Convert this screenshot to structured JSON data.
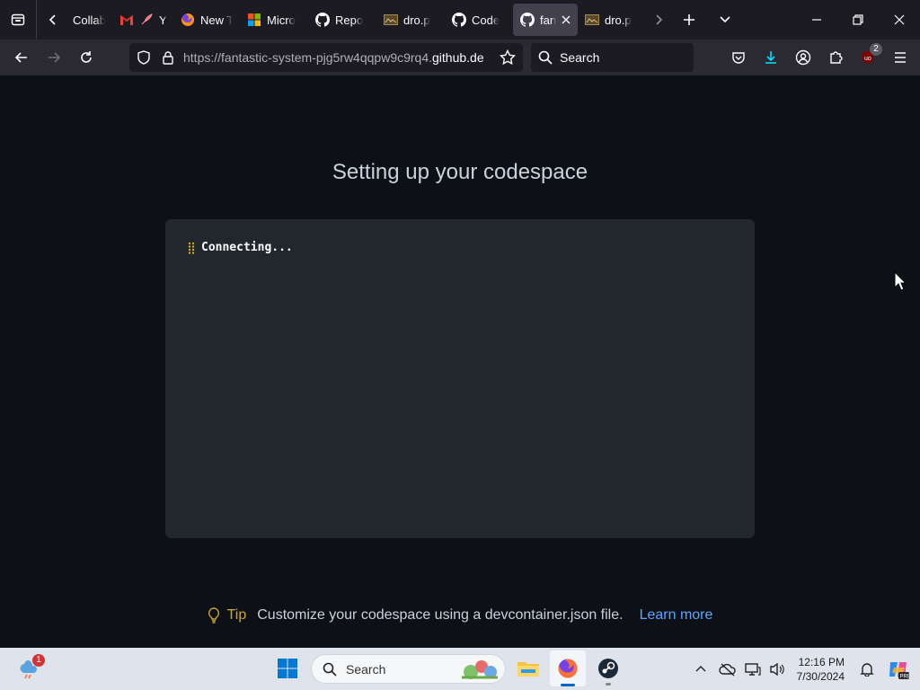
{
  "browser": {
    "tabs": [
      {
        "label": "Collab",
        "icon": "collab-icon"
      },
      {
        "label": "Yo",
        "icon": "gmail-icon"
      },
      {
        "label": "New T",
        "icon": "firefox-icon"
      },
      {
        "label": "Micro",
        "icon": "microsoft-icon"
      },
      {
        "label": "Repo",
        "icon": "github-icon"
      },
      {
        "label": "dro.p",
        "icon": "file-icon"
      },
      {
        "label": "Code",
        "icon": "github-icon"
      },
      {
        "label": "fan",
        "icon": "github-icon",
        "active": true
      },
      {
        "label": "dro.p",
        "icon": "file-icon"
      }
    ],
    "url_prefix": "https://fantastic-system-pjg5rw4qqpw9c9rq4.",
    "url_domain": "github.de",
    "search_placeholder": "Search",
    "extension_badge": "2"
  },
  "page": {
    "title": "Setting up your codespace",
    "terminal_status": "Connecting...",
    "tip_label": "Tip",
    "tip_text": "Customize your codespace using a devcontainer.json file.",
    "tip_link": "Learn more"
  },
  "taskbar": {
    "search_placeholder": "Search",
    "time": "12:16 PM",
    "date": "7/30/2024",
    "weather_badge": "1"
  },
  "colors": {
    "page_bg": "#0d1117",
    "terminal_bg": "#22272e",
    "link": "#58a6ff",
    "tip": "#d4a72c"
  }
}
